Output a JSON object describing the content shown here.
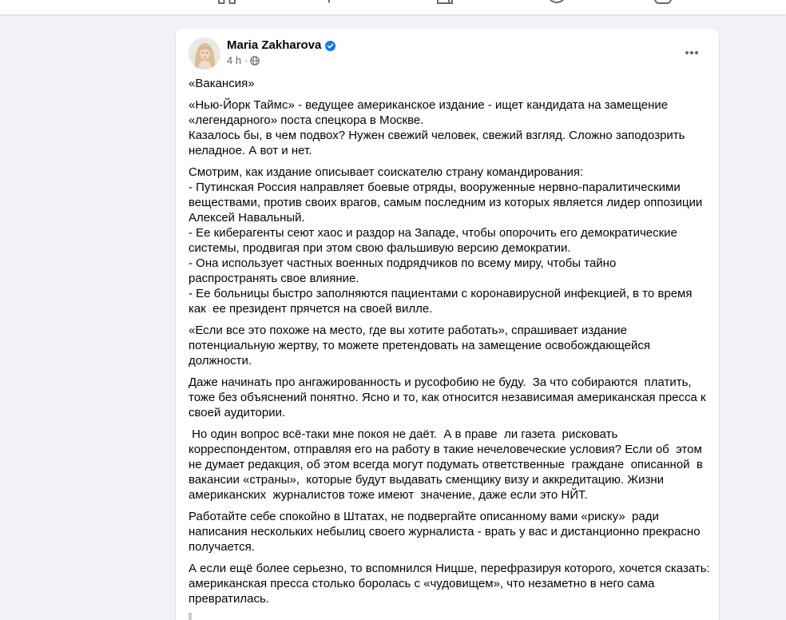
{
  "header": {
    "nav_icons": [
      "home-icon",
      "watch-icon",
      "marketplace-icon",
      "groups-icon",
      "gaming-icon"
    ]
  },
  "post": {
    "author": {
      "name": "Maria Zakharova",
      "verified": true,
      "verified_icon": "verified-badge-icon"
    },
    "meta": {
      "time": "4 h",
      "separator": "·",
      "audience_icon": "globe-icon"
    },
    "menu_icon": "more-options-icon",
    "paragraphs": [
      [
        "«Вакансия»"
      ],
      [
        "«Нью-Йорк Таймс» - ведущее американское издание - ищет кандидата на замещение",
        "«легендарного» поста спецкора в Москве.",
        "Казалось бы, в чем подвох? Нужен свежий человек, свежий взгляд. Сложно заподозрить",
        "неладное. А вот и нет."
      ],
      [
        "Смотрим, как издание описывает соискателю страну командирования:",
        "- Путинская Россия направляет боевые отряды, вооруженные нервно-паралитическими",
        "веществами, против своих врагов, самым последним из которых является лидер оппозиции",
        "Алексей Навальный.",
        "- Ее киберагенты сеют хаос и раздор на Западе, чтобы опорочить его демократические",
        "системы, продвигая при этом свою фальшивую версию демократии.",
        "- Она использует частных военных подрядчиков по всему миру, чтобы тайно",
        "распространять свое влияние.",
        "- Ее больницы быстро заполняются пациентами с коронавирусной инфекцией, в то время",
        "как  ее президент прячется на своей вилле."
      ],
      [
        "«Если все это похоже на место, где вы хотите работать», спрашивает издание",
        "потенциальную жертву, то можете претендовать на замещение освобождающейся",
        "должности."
      ],
      [
        "Даже начинать про ангажированность и русофобию не буду.  За что собираются  платить,",
        "тоже без объяснений понятно. Ясно и то, как относится независимая американская пресса к",
        "своей аудитории."
      ],
      [
        " Но один вопрос всё-таки мне покоя не даёт.  А в праве  ли газета  рисковать",
        "корреспондентом, отправляя его на работу в такие нечеловеческие условия? Если об  этом",
        "не думает редакция, об этом всегда могут подумать ответственные  граждане  описанной  в",
        "вакансии «страны»,  которые будут выдавать сменщику визу и аккредитацию. Жизни",
        "американских  журналистов тоже имеют  значение, даже если это НЙТ."
      ],
      [
        "Работайте себе спокойно в Штатах, не подвергайте описанному вами «риску»  ради",
        "написания нескольких небылиц своего журналиста - врать у вас и дистанционно прекрасно",
        "получается."
      ],
      [
        "А если ещё более серьезно, то вспомнился Ницше, перефразируя которого, хочется сказать:",
        "американская пресса столько боролась с «чудовищем», что незаметно в него сама",
        "превратилась."
      ]
    ]
  },
  "colors": {
    "page_background": "#f0f2f5",
    "card_background": "#ffffff",
    "primary_text": "#050505",
    "secondary_text": "#65676b",
    "verified_badge": "#1877f2",
    "quote_bar": "#c9ccd1"
  }
}
